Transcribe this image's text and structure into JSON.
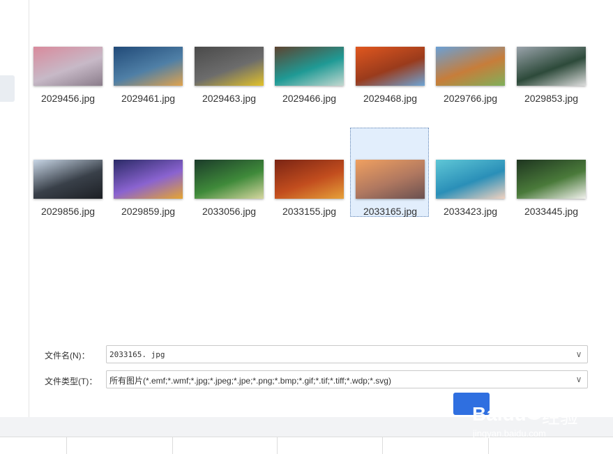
{
  "files": [
    {
      "name": "2029456.jpg",
      "thumb_icon": "cat-photo-icon",
      "colors": [
        "#d98a9c",
        "#c7b9c7",
        "#8a7c8a"
      ]
    },
    {
      "name": "2029461.jpg",
      "thumb_icon": "city-night-photo-icon",
      "colors": [
        "#214a78",
        "#4f7fa6",
        "#e0a34e"
      ]
    },
    {
      "name": "2029463.jpg",
      "thumb_icon": "car-photo-icon",
      "colors": [
        "#4a4a4a",
        "#6c6c6c",
        "#e2c22a"
      ]
    },
    {
      "name": "2029466.jpg",
      "thumb_icon": "coast-aerial-photo-icon",
      "colors": [
        "#5d4330",
        "#1f9a95",
        "#c4d8d0"
      ]
    },
    {
      "name": "2029468.jpg",
      "thumb_icon": "autumn-road-photo-icon",
      "colors": [
        "#e0571f",
        "#9a3b1c",
        "#6da5d6"
      ]
    },
    {
      "name": "2029766.jpg",
      "thumb_icon": "dog-photo-icon",
      "colors": [
        "#6aa0d6",
        "#c77d3a",
        "#7fb05b"
      ]
    },
    {
      "name": "2029853.jpg",
      "thumb_icon": "lake-village-photo-icon",
      "colors": [
        "#9aa3ab",
        "#2d4a3a",
        "#dedede"
      ]
    },
    {
      "name": "2029856.jpg",
      "thumb_icon": "pebble-beach-photo-icon",
      "colors": [
        "#c8d6e6",
        "#394049",
        "#1c1f24"
      ]
    },
    {
      "name": "2029859.jpg",
      "thumb_icon": "game-art-photo-icon",
      "colors": [
        "#2a2a66",
        "#8a63d0",
        "#e6a530"
      ]
    },
    {
      "name": "2033056.jpg",
      "thumb_icon": "anime-photo-icon",
      "colors": [
        "#1b3b2a",
        "#3f8a3a",
        "#d6d6a0"
      ]
    },
    {
      "name": "2033155.jpg",
      "thumb_icon": "forest-steps-photo-icon",
      "colors": [
        "#7a2414",
        "#c24d1e",
        "#e6a13a"
      ]
    },
    {
      "name": "2033165.jpg",
      "thumb_icon": "paris-sunset-photo-icon",
      "colors": [
        "#f0a060",
        "#b07860",
        "#6a5050"
      ],
      "selected": true
    },
    {
      "name": "2033423.jpg",
      "thumb_icon": "portrait-photo-icon",
      "colors": [
        "#5fc7d6",
        "#2a8fb8",
        "#f2d2c0"
      ]
    },
    {
      "name": "2033445.jpg",
      "thumb_icon": "white-flower-photo-icon",
      "colors": [
        "#1e3520",
        "#4a7a3a",
        "#f2f2ee"
      ]
    }
  ],
  "filename": {
    "label": "文件名(N)：",
    "value": "2033165. jpg"
  },
  "filetype": {
    "label": "文件类型(T)：",
    "value": "所有图片(*.emf;*.wmf;*.jpg;*.jpeg;*.jpe;*.png;*.bmp;*.gif;*.tif;*.tiff;*.wdp;*.svg)"
  },
  "watermark": {
    "brand": "Baidu",
    "cn": "经验",
    "url": "jingyan.baidu.com"
  },
  "colors": {
    "selection_bg": "#e2eefc",
    "selection_border": "#5b7fb0",
    "ok_button": "#2f6fe0"
  }
}
